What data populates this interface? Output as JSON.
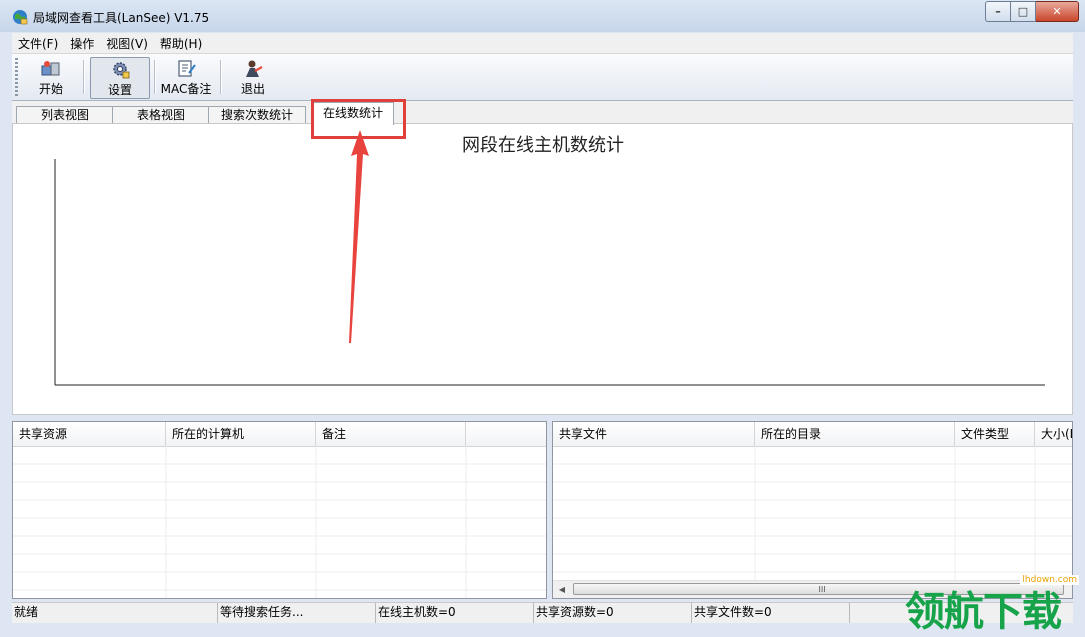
{
  "window": {
    "title": "局域网查看工具(LanSee) V1.75",
    "min": "–",
    "max": "□",
    "close": "✕"
  },
  "menu": [
    {
      "label": "文件(F)"
    },
    {
      "label": "操作"
    },
    {
      "label": "视图(V)"
    },
    {
      "label": "帮助(H)"
    }
  ],
  "toolbar": {
    "start": {
      "label": "开始",
      "icon": "start-icon"
    },
    "settings": {
      "label": "设置",
      "icon": "settings-gear-icon"
    },
    "mac": {
      "label": "MAC备注",
      "icon": "mac-note-icon"
    },
    "exit": {
      "label": "退出",
      "icon": "exit-icon"
    }
  },
  "tabs": [
    {
      "label": "列表视图",
      "active": false
    },
    {
      "label": "表格视图",
      "active": false
    },
    {
      "label": "搜索次数统计",
      "active": false
    },
    {
      "label": "在线数统计",
      "active": true
    }
  ],
  "chart_data": {
    "type": "bar",
    "title": "网段在线主机数统计",
    "categories": [],
    "values": [],
    "xlabel": "",
    "ylabel": ""
  },
  "shares_list": {
    "columns": [
      "共享资源",
      "所在的计算机",
      "备注",
      ""
    ],
    "rows": []
  },
  "files_list": {
    "columns": [
      "共享文件",
      "所在的目录",
      "文件类型",
      "大小(K"
    ],
    "rows": [],
    "scroll_grip": "III"
  },
  "status": {
    "ready": "就绪",
    "task": "等待搜索任务...",
    "online_hosts": "在线主机数=0",
    "shared_resources": "共享资源数=0",
    "shared_files": "共享文件数=0"
  },
  "colors": {
    "annotation": "#e0403b",
    "watermark": "#16a34a"
  },
  "watermark": {
    "text": "领航下载",
    "site": "lhdown.com"
  }
}
